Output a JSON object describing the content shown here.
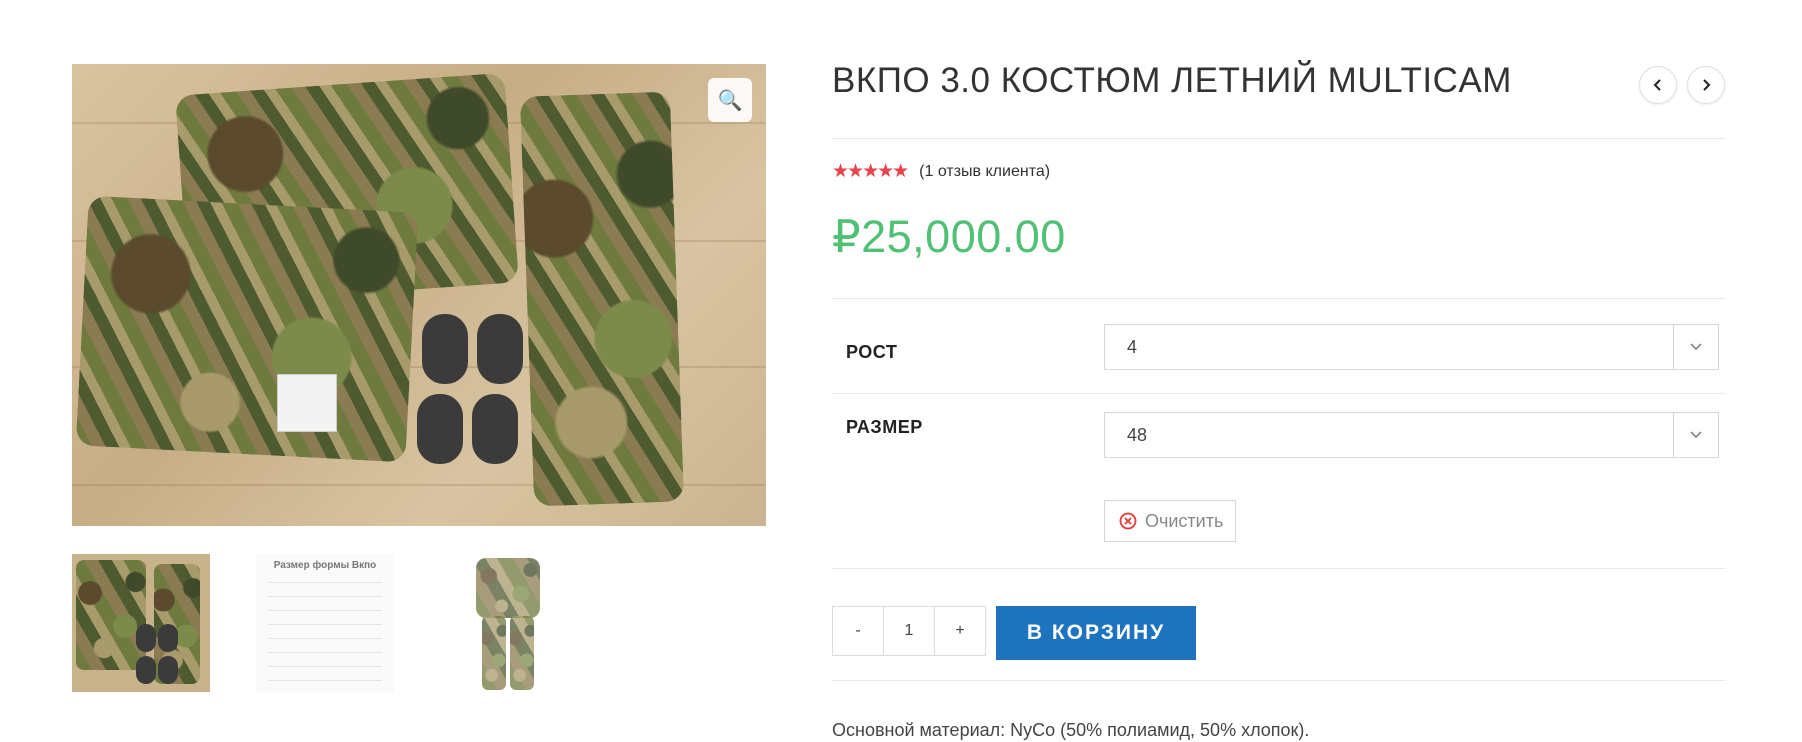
{
  "product": {
    "title": "ВКПО 3.0 КОСТЮМ ЛЕТНИЙ MULTICAM",
    "rating_stars": "★★★★★",
    "rating_value": 5,
    "reviews_text": "(1 отзыв клиента)",
    "price": "₽25,000.00",
    "price_color": "#4fc074"
  },
  "gallery": {
    "zoom_icon": "🔍",
    "thumb_table_title": "Размер формы Вкпо",
    "thumbs": [
      "product-photo",
      "size-table",
      "model-photo"
    ]
  },
  "variations": [
    {
      "label": "РОСТ",
      "value": "4"
    },
    {
      "label": "РАЗМЕР",
      "value": "48"
    }
  ],
  "reset_label": "Очистить",
  "quantity": {
    "minus": "-",
    "value": "1",
    "plus": "+"
  },
  "add_to_cart_label": "В КОРЗИНУ",
  "description": "Основной материал: NyCo (50% полиамид, 50% хлопок).",
  "colors": {
    "accent": "#1e73be",
    "stars": "#e8454b"
  }
}
